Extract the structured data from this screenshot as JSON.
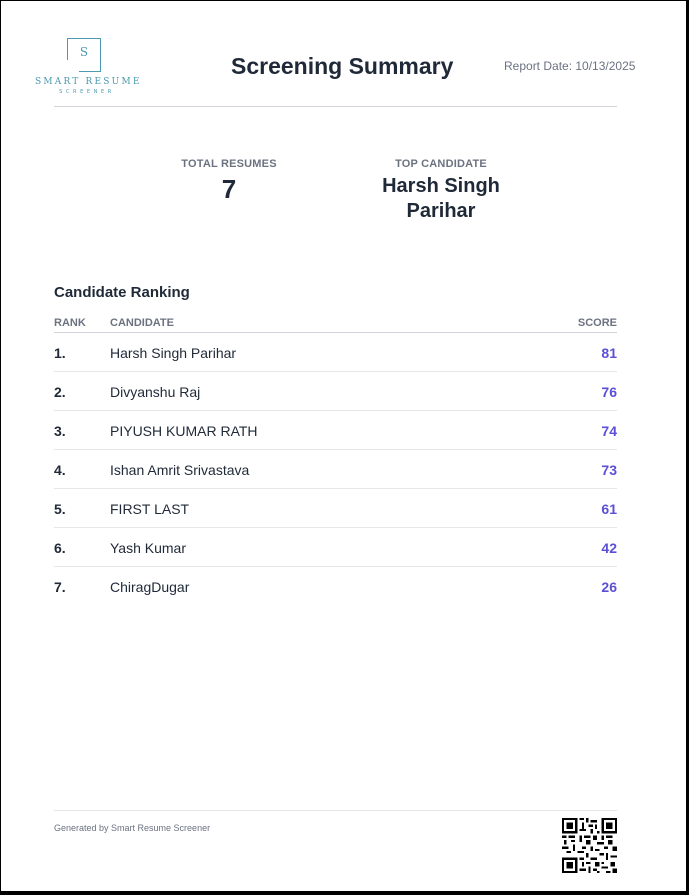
{
  "logo": {
    "letter": "S",
    "name": "SMART RESUME",
    "sub": "SCREENER",
    "color": "#4b9ab0"
  },
  "header": {
    "title": "Screening Summary",
    "report_date": "Report Date: 10/13/2025"
  },
  "stats": {
    "total_label": "TOTAL RESUMES",
    "total_value": "7",
    "top_label": "TOP CANDIDATE",
    "top_value": "Harsh Singh Parihar"
  },
  "ranking": {
    "title": "Candidate Ranking",
    "columns": {
      "rank": "RANK",
      "candidate": "CANDIDATE",
      "score": "SCORE"
    },
    "rows": [
      {
        "rank": "1.",
        "name": "Harsh Singh Parihar",
        "score": "81"
      },
      {
        "rank": "2.",
        "name": "Divyanshu Raj",
        "score": "76"
      },
      {
        "rank": "3.",
        "name": "PIYUSH KUMAR RATH",
        "score": "74"
      },
      {
        "rank": "4.",
        "name": "Ishan Amrit Srivastava",
        "score": "73"
      },
      {
        "rank": "5.",
        "name": "FIRST LAST",
        "score": "61"
      },
      {
        "rank": "6.",
        "name": "Yash Kumar",
        "score": "42"
      },
      {
        "rank": "7.",
        "name": "ChiragDugar",
        "score": "26"
      }
    ]
  },
  "footer": {
    "text": "Generated by Smart Resume Screener",
    "qr_icon": "qr-code-icon"
  },
  "colors": {
    "score": "#5b4fd6",
    "text": "#1f2937",
    "muted": "#6b7280"
  }
}
